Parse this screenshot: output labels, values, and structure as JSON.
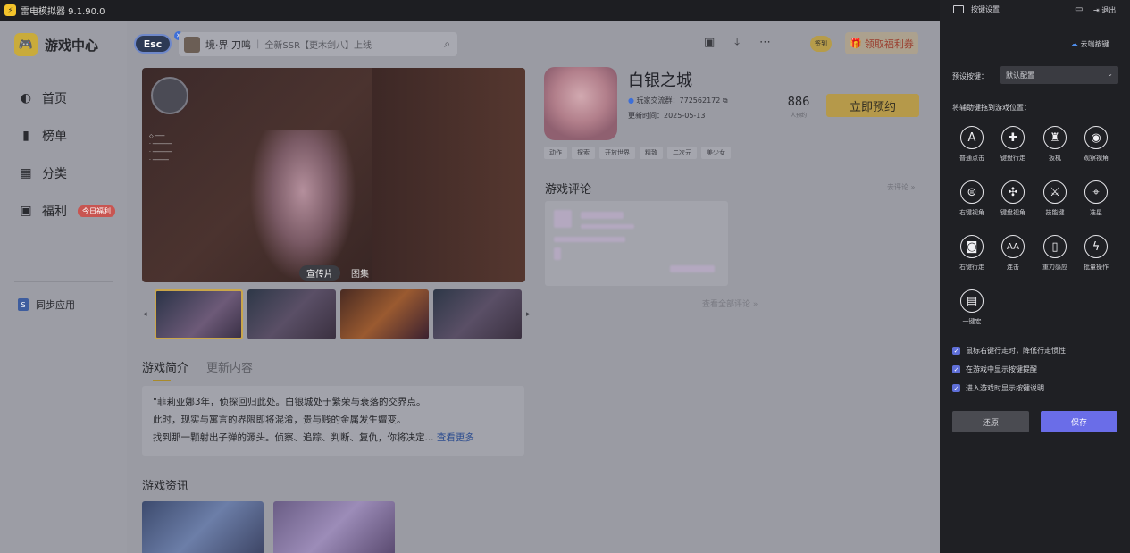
{
  "titlebar": {
    "title": "雷电模拟器 9.1.90.0"
  },
  "sidebar": {
    "brand": "游戏中心",
    "items": [
      {
        "label": "首页",
        "icon": "gamepad-icon"
      },
      {
        "label": "榜单",
        "icon": "bar-chart-icon"
      },
      {
        "label": "分类",
        "icon": "grid-icon"
      },
      {
        "label": "福利",
        "icon": "gift-icon",
        "badge": "今日福利"
      }
    ],
    "sync_label": "同步应用"
  },
  "header": {
    "esc": "Esc",
    "search_keyword": "境·界 刀鸣",
    "search_hint": "全新SSR【更木剑八】上线",
    "sign_label": "签到",
    "gift_label": "领取福利券"
  },
  "media": {
    "tabs": [
      "宣传片",
      "图集"
    ]
  },
  "game": {
    "title": "白银之城",
    "qq_group": "玩家交流群：772562172",
    "updated": "更新时间：2025-05-13",
    "reserve_count": "886",
    "reserve_count_label": "人预约",
    "reserve_button": "立即预约",
    "tags": [
      "动作",
      "探索",
      "开放世界",
      "精致",
      "二次元",
      "美少女"
    ]
  },
  "reviews": {
    "title": "游戏评论",
    "more": "去评论 »",
    "all": "查看全部评论 »"
  },
  "intro": {
    "tabs": [
      "游戏简介",
      "更新内容"
    ],
    "line1": "\"菲莉亚娜3年，侦探回归此处。白银城处于繁荣与衰落的交界点。",
    "line2": "此时，现实与寓言的界限即将混淆，贵与贱的金属发生嬗变。",
    "line3": "找到那一颗射出子弹的源头。侦察、追踪、判断、复仇，你将决定...",
    "more": "查看更多"
  },
  "news": {
    "title": "游戏资讯"
  },
  "panel": {
    "title": "按键设置",
    "exit": "退出",
    "cloud": "云端按键",
    "preset_label": "预设按键：",
    "preset_value": "默认配置",
    "drag_hint": "将辅助键拖到游戏位置：",
    "keys": [
      {
        "label": "普通点击",
        "icon": "letter-a-icon"
      },
      {
        "label": "键盘行走",
        "icon": "dpad-icon"
      },
      {
        "label": "扳机",
        "icon": "bullet-icon"
      },
      {
        "label": "观察视角",
        "icon": "eye-icon"
      },
      {
        "label": "右键视角",
        "icon": "mouse-view-icon"
      },
      {
        "label": "键盘视角",
        "icon": "keyboard-view-icon"
      },
      {
        "label": "技能键",
        "icon": "swords-icon"
      },
      {
        "label": "准星",
        "icon": "crosshair-icon"
      },
      {
        "label": "右键行走",
        "icon": "mouse-icon"
      },
      {
        "label": "连击",
        "icon": "double-a-icon"
      },
      {
        "label": "重力感应",
        "icon": "gravity-icon"
      },
      {
        "label": "批量操作",
        "icon": "lightning-icon"
      },
      {
        "label": "一键宏",
        "icon": "macro-icon"
      }
    ],
    "options": [
      "鼠标右键行走时，降低行走惯性",
      "在游戏中显示按键提醒",
      "进入游戏时显示按键说明"
    ],
    "restore": "还原",
    "save": "保存"
  }
}
